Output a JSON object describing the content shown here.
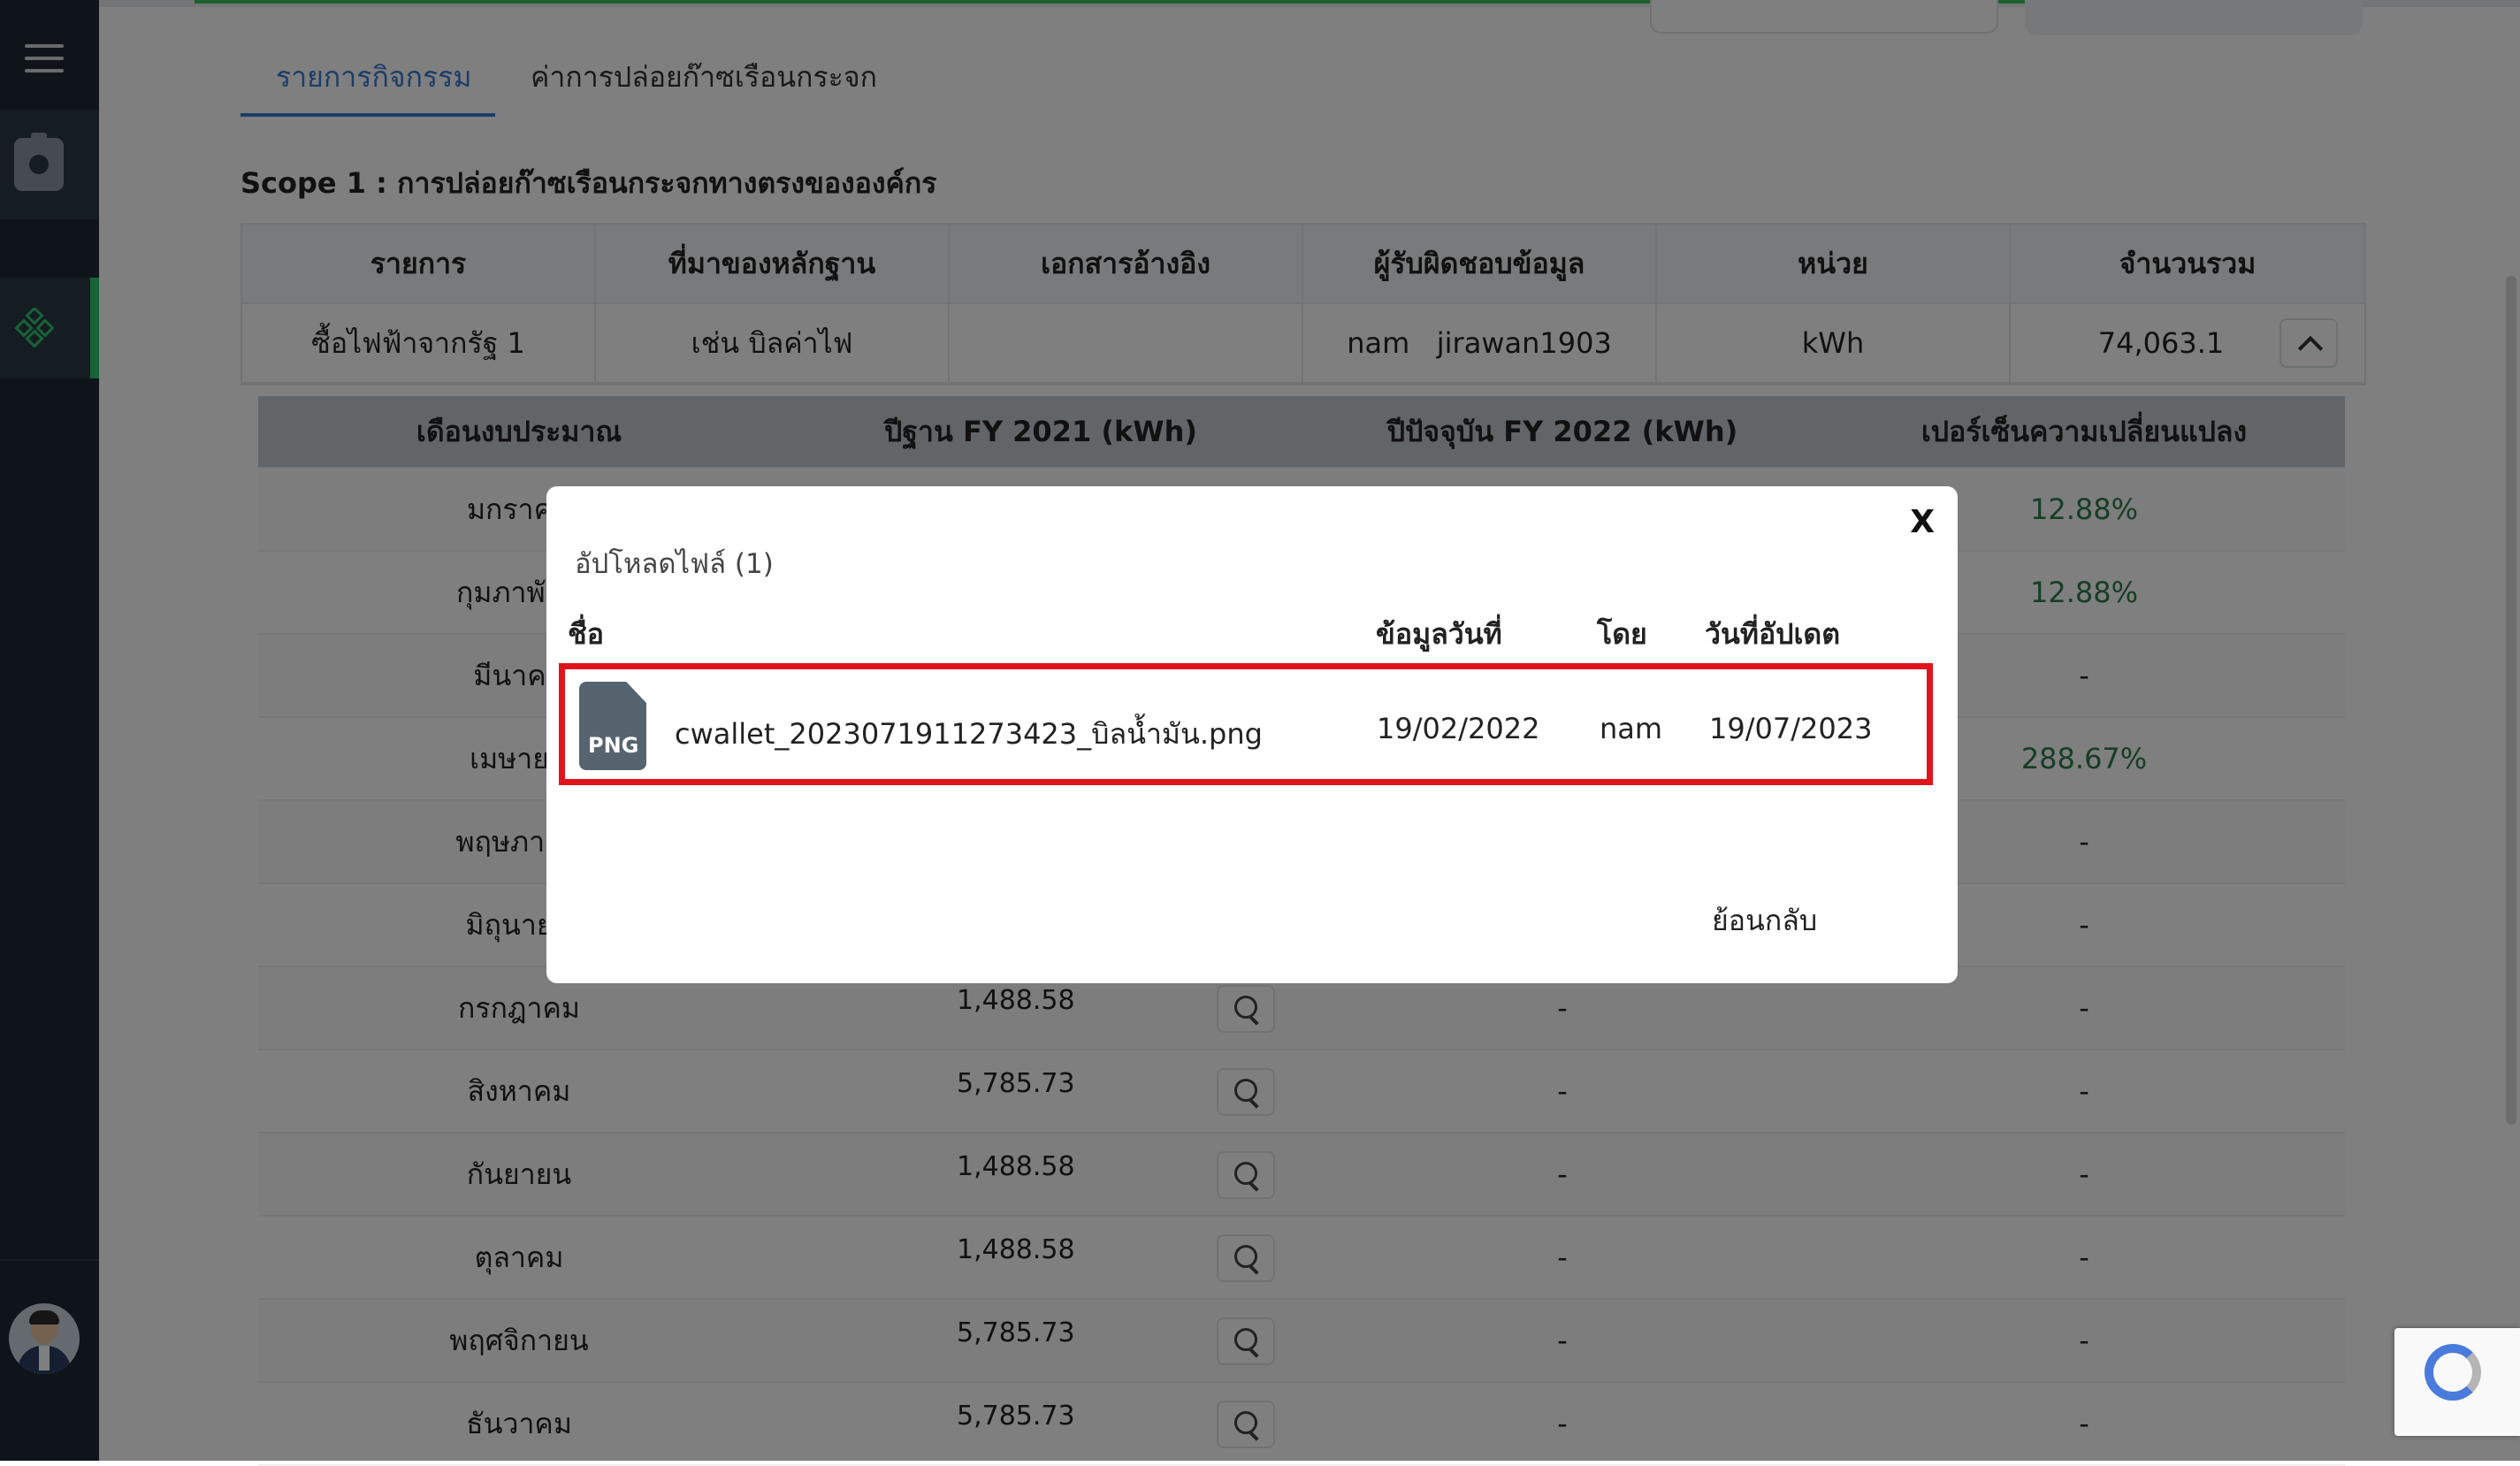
{
  "tabs": [
    "รายการกิจกรรม",
    "ค่าการปล่อยก๊าซเรือนกระจก"
  ],
  "scope_title": "Scope 1 : การปล่อยก๊าซเรือนกระจกทางตรงขององค์กร",
  "main_table": {
    "headers": [
      "รายการ",
      "ที่มาของหลักฐาน",
      "เอกสารอ้างอิง",
      "ผู้รับผิดชอบข้อมูล",
      "หน่วย",
      "จำนวนรวม"
    ],
    "row": [
      "ซื้อไฟฟ้าจากรัฐ 1",
      "เช่น บิลค่าไฟ",
      "",
      "nam   jirawan1903",
      "kWh",
      "74,063.1"
    ]
  },
  "inner_table": {
    "headers": [
      "เดือนงบประมาณ",
      "ปีฐาน FY 2021 (kWh)",
      "ปีปัจจุบัน FY 2022 (kWh)",
      "เปอร์เซ็นความเปลี่ยนแปลง"
    ],
    "rows": [
      {
        "month": "มกราคม",
        "base": "",
        "current": "",
        "pct": "12.88%"
      },
      {
        "month": "กุมภาพันธ์",
        "base": "",
        "current": "",
        "pct": "12.88%"
      },
      {
        "month": "มีนาคม",
        "base": "",
        "current": "",
        "pct": "-"
      },
      {
        "month": "เมษายน",
        "base": "",
        "current": "",
        "pct": "288.67%"
      },
      {
        "month": "พฤษภาคม",
        "base": "",
        "current": "",
        "pct": "-"
      },
      {
        "month": "มิถุนายน",
        "base": "",
        "current": "",
        "pct": "-"
      },
      {
        "month": "กรกฎาคม",
        "base": "1,488.58",
        "current": "-",
        "pct": "-"
      },
      {
        "month": "สิงหาคม",
        "base": "5,785.73",
        "current": "-",
        "pct": "-"
      },
      {
        "month": "กันยายน",
        "base": "1,488.58",
        "current": "-",
        "pct": "-"
      },
      {
        "month": "ตุลาคม",
        "base": "1,488.58",
        "current": "-",
        "pct": "-"
      },
      {
        "month": "พฤศจิกายน",
        "base": "5,785.73",
        "current": "-",
        "pct": "-"
      },
      {
        "month": "ธันวาคม",
        "base": "5,785.73",
        "current": "-",
        "pct": "-"
      }
    ]
  },
  "modal": {
    "title": "อัปโหลดไฟล์ (1)",
    "close": "X",
    "headers": {
      "name": "ชื่อ",
      "data_date": "ข้อมูลวันที่",
      "by": "โดย",
      "updated": "วันที่อัปเดต"
    },
    "file": {
      "type_label": "PNG",
      "name": "cwallet_20230719112734​23_บิลน้ำมัน.png",
      "data_date": "19/02/2022",
      "by": "nam",
      "updated": "19/07/2023"
    },
    "back": "ย้อนกลับ"
  },
  "colors": {
    "accent": "#3b7bd1",
    "positive": "#2e7d4a",
    "highlight_border": "#e0141c",
    "sidebar": "#1e2935"
  },
  "icons": [
    "menu-icon",
    "camera-icon",
    "diamond-icon",
    "chevron-up-icon",
    "search-icon",
    "png-file-icon",
    "recaptcha-icon"
  ]
}
